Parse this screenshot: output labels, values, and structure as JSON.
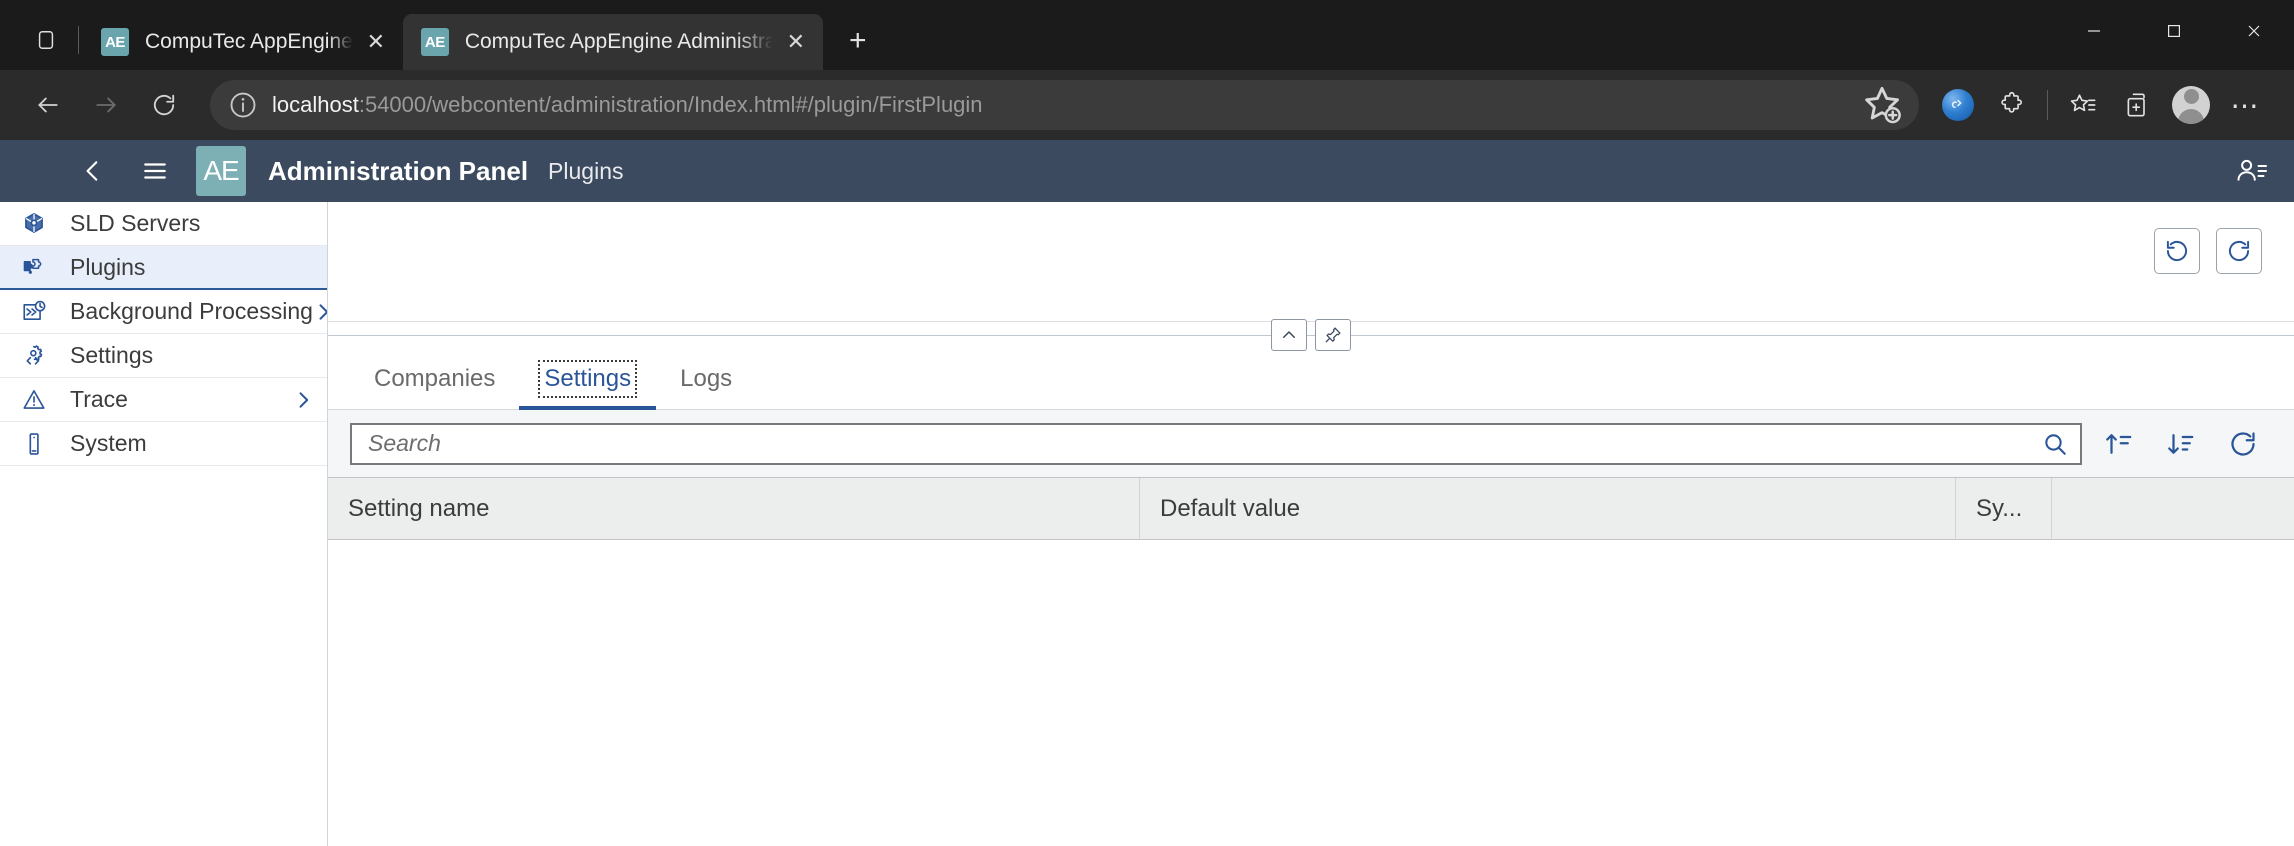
{
  "browser": {
    "tab_list_icon": "tab-list-icon",
    "tabs": [
      {
        "favicon": "AE",
        "title": "CompuTec AppEngine",
        "close_label": "✕",
        "active": false
      },
      {
        "favicon": "AE",
        "title": "CompuTec AppEngine Administration",
        "close_label": "✕",
        "active": true
      }
    ],
    "new_tab_label": "+",
    "window_controls": {
      "minimize": "minimize-icon",
      "maximize": "maximize-icon",
      "close": "close-icon"
    },
    "nav": {
      "back_icon": "back-arrow-icon",
      "forward_icon": "forward-arrow-icon",
      "refresh_icon": "refresh-icon",
      "info_icon": "site-information-icon",
      "url_host": "localhost",
      "url_path": ":54000/webcontent/administration/Index.html#/plugin/FirstPlugin",
      "url_full": "localhost:54000/webcontent/administration/Index.html#/plugin/FirstPlugin",
      "add_favorite_icon": "add-favorite-star-icon"
    },
    "toolbar": [
      {
        "name": "copilot-icon",
        "label": ""
      },
      {
        "name": "extensions-puzzle-icon",
        "label": ""
      },
      {
        "name": "favorites-star-list-icon",
        "label": ""
      },
      {
        "name": "collections-icon",
        "label": ""
      },
      {
        "name": "profile-avatar-icon",
        "label": ""
      },
      {
        "name": "settings-and-more-icon",
        "label": "⋯"
      }
    ]
  },
  "app": {
    "header": {
      "back_icon": "back-chevron-icon",
      "menu_icon": "hamburger-menu-icon",
      "logo_text": "AE",
      "title": "Administration Panel",
      "subtitle": "Plugins",
      "user_icon": "user-account-icon"
    },
    "sidebar": {
      "items": [
        {
          "label": "SLD Servers",
          "icon": "cube-icon",
          "active": false,
          "has_chevron": false
        },
        {
          "label": "Plugins",
          "icon": "puzzle-piece-icon",
          "active": true,
          "has_chevron": false
        },
        {
          "label": "Background Processing",
          "icon": "background-processing-icon",
          "active": false,
          "has_chevron": true
        },
        {
          "label": "Settings",
          "icon": "gear-code-icon",
          "active": false,
          "has_chevron": false
        },
        {
          "label": "Trace",
          "icon": "warning-triangle-icon",
          "active": false,
          "has_chevron": true
        },
        {
          "label": "System",
          "icon": "system-device-icon",
          "active": false,
          "has_chevron": false
        }
      ]
    },
    "top_panel": {
      "refresh_buttons": [
        {
          "name": "refresh-left-button",
          "icon": "refresh-ccw-icon"
        },
        {
          "name": "refresh-right-button",
          "icon": "refresh-cw-icon"
        }
      ]
    },
    "splitter": {
      "collapse_icon": "chevron-up-icon",
      "pin_icon": "pin-icon"
    },
    "tabs": [
      {
        "label": "Companies",
        "active": false,
        "focused": false
      },
      {
        "label": "Settings",
        "active": true,
        "focused": true
      },
      {
        "label": "Logs",
        "active": false,
        "focused": false
      }
    ],
    "toolbar": {
      "search_placeholder": "Search",
      "search_value": "",
      "search_icon": "magnifier-icon",
      "buttons": [
        {
          "name": "collapse-all-button",
          "icon": "collapse-rows-icon"
        },
        {
          "name": "sort-descending-button",
          "icon": "sort-descending-icon"
        },
        {
          "name": "refresh-table-button",
          "icon": "refresh-cw-icon"
        }
      ]
    },
    "table": {
      "columns": [
        {
          "label": "Setting name",
          "key": "setting_name"
        },
        {
          "label": "Default value",
          "key": "default_value"
        },
        {
          "label": "Sy...",
          "key": "system"
        },
        {
          "label": "",
          "key": "extra"
        }
      ],
      "rows": []
    }
  },
  "colors": {
    "app_header_bg": "#3b4a5e",
    "accent_blue": "#2a5599",
    "logo_teal": "#7cb0b5",
    "sidebar_active_bg": "#e8eefa",
    "browser_chrome": "#1b1b1b",
    "navbar_bg": "#2b2b2b"
  }
}
